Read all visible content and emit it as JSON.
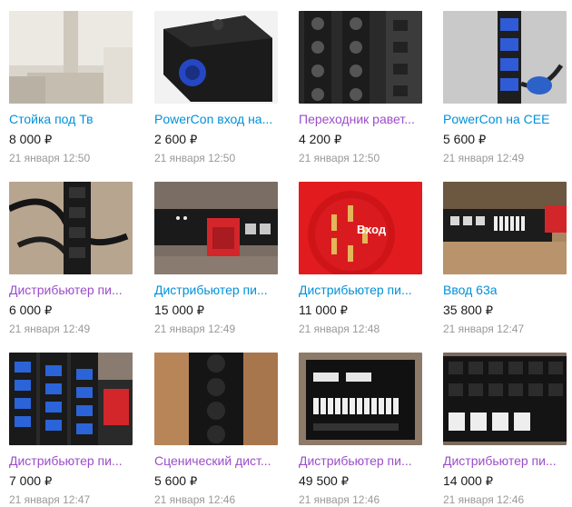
{
  "colors": {
    "link": "#0091d9",
    "visited": "#9b4dca",
    "price": "#1a1a1a",
    "date": "#999999"
  },
  "items": [
    {
      "title": "Стойка под Тв",
      "price": "8 000",
      "currency": "₽",
      "date": "21 января 12:50",
      "visited": false,
      "thumb": "tv-stand"
    },
    {
      "title": "PowerCon вход на...",
      "price": "2 600",
      "currency": "₽",
      "date": "21 января 12:50",
      "visited": false,
      "thumb": "powercon-box"
    },
    {
      "title": "Переходник равет...",
      "price": "4 200",
      "currency": "₽",
      "date": "21 января 12:50",
      "visited": true,
      "thumb": "speakon-panel"
    },
    {
      "title": "PowerCon на CEE",
      "price": "5 600",
      "currency": "₽",
      "date": "21 января 12:49",
      "visited": false,
      "thumb": "powercon-cee"
    },
    {
      "title": "Дистрибьютер пи...",
      "price": "6 000",
      "currency": "₽",
      "date": "21 января 12:49",
      "visited": true,
      "thumb": "distributor-cable"
    },
    {
      "title": "Дистрибьютер пи...",
      "price": "15 000",
      "currency": "₽",
      "date": "21 января 12:49",
      "visited": false,
      "thumb": "rack-red-plug"
    },
    {
      "title": "Дистрибьютер пи...",
      "price": "11 000",
      "currency": "₽",
      "date": "21 января 12:48",
      "visited": false,
      "thumb": "red-cee-plug",
      "thumb_label": "Вход"
    },
    {
      "title": "Ввод 63а",
      "price": "35 800",
      "currency": "₽",
      "date": "21 января 12:47",
      "visited": false,
      "thumb": "rack-63a"
    },
    {
      "title": "Дистрибьютер пи...",
      "price": "7 000",
      "currency": "₽",
      "date": "21 января 12:47",
      "visited": true,
      "thumb": "blue-sockets"
    },
    {
      "title": "Сценический дист...",
      "price": "5 600",
      "currency": "₽",
      "date": "21 января 12:46",
      "visited": true,
      "thumb": "schuko-strip"
    },
    {
      "title": "Дистрибьютер пи...",
      "price": "49 500",
      "currency": "₽",
      "date": "21 января 12:46",
      "visited": true,
      "thumb": "breaker-rack"
    },
    {
      "title": "Дистрибьютер пи...",
      "price": "14 000",
      "currency": "₽",
      "date": "21 января 12:46",
      "visited": true,
      "thumb": "socket-breakers"
    }
  ]
}
